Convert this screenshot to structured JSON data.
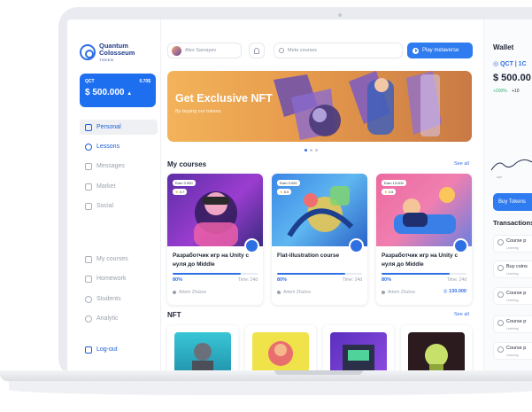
{
  "brand": {
    "line1": "Quantum",
    "line2": "Colosseum",
    "line3": "TOKEN"
  },
  "balance": {
    "currency": "QCT",
    "rate": "0.70$",
    "amount": "$ 500.000"
  },
  "nav": {
    "top": [
      {
        "label": "Personal",
        "icon": "briefcase-icon"
      },
      {
        "label": "Lessons",
        "icon": "lessons-icon"
      },
      {
        "label": "Messages",
        "icon": "chat-icon"
      },
      {
        "label": "Market",
        "icon": "market-icon"
      },
      {
        "label": "Social",
        "icon": "social-icon"
      }
    ],
    "bottom": [
      {
        "label": "My courses",
        "icon": "courses-icon"
      },
      {
        "label": "Homework",
        "icon": "homework-icon"
      },
      {
        "label": "Students",
        "icon": "students-icon"
      },
      {
        "label": "Analytic",
        "icon": "analytic-icon"
      }
    ],
    "logout": "Log-out"
  },
  "topbar": {
    "user_name": "Alex Sarvayev",
    "search_placeholder": "Meta courses",
    "play_label": "Play metaverse"
  },
  "banner": {
    "title": "Get Exclusive NFT",
    "subtitle": "By buying our tokens"
  },
  "courses": {
    "title": "My courses",
    "see_all": "See all",
    "items": [
      {
        "earn": "Earn 3.000",
        "rating": "4.7",
        "title": "Разработчик игр на Unity с нуля до Middle",
        "progress_label": "80%",
        "progress": 0.8,
        "time": "Time: 24d",
        "author": "Artem Zhukov",
        "price": ""
      },
      {
        "earn": "Earn 3.000",
        "rating": "5.0",
        "title": "Flat-illustration course",
        "progress_label": "80%",
        "progress": 0.8,
        "time": "Time: 24d",
        "author": "Artem Zhukov",
        "price": ""
      },
      {
        "earn": "Earn 13.000",
        "rating": "4.5",
        "title": "Разработчик игр на Unity с нуля до Middle",
        "progress_label": "80%",
        "progress": 0.8,
        "time": "Time: 24d",
        "author": "Artem Zhukov",
        "price": "130.000"
      }
    ]
  },
  "nft": {
    "title": "NFT",
    "see_all": "See all"
  },
  "wallet": {
    "title": "Wallet",
    "currency": "QCT | 1C",
    "amount": "$ 500.00",
    "change": "+200%",
    "change2": "+10",
    "chart_label": "Apr",
    "buy_label": "Buy Tokens",
    "transactions_title": "Transactions",
    "transactions": [
      {
        "label": "Course p",
        "sub": "Learning"
      },
      {
        "label": "Buy coins",
        "sub": "Learning"
      },
      {
        "label": "Course p",
        "sub": "Learning"
      },
      {
        "label": "Course p",
        "sub": "Learning"
      },
      {
        "label": "Course p",
        "sub": "Learning"
      }
    ]
  },
  "colors": {
    "accent": "#2f6fe4",
    "primary_button": "#2f7bf0",
    "positive": "#2fae6b"
  }
}
